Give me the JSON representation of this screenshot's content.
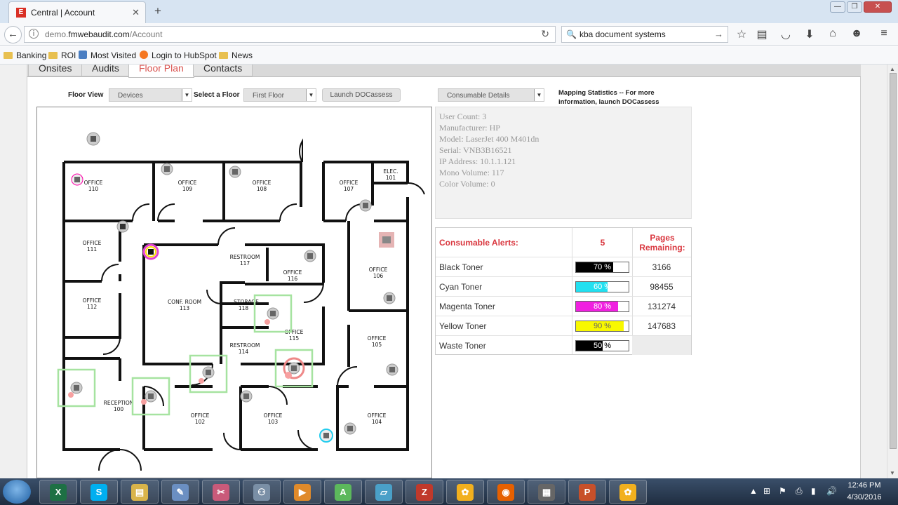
{
  "browser": {
    "tab_title": "Central | Account",
    "tab_favicon": "E",
    "new_tab": "+",
    "url_prefix": "demo.",
    "url_host": "fmwebaudit.com",
    "url_path": "/Account",
    "search_text": "kba document systems",
    "bookmarks": [
      "Banking",
      "ROI",
      "Most Visited",
      "Login to HubSpot",
      "News"
    ]
  },
  "page": {
    "tabs": [
      "Onsites",
      "Audits",
      "Floor Plan",
      "Contacts"
    ],
    "active_tab": "Floor Plan",
    "floor_view_label": "Floor View",
    "floor_view_value": "Devices",
    "select_floor_label": "Select a Floor",
    "select_floor_value": "First Floor",
    "launch_button": "Launch DOCassess",
    "consumable_dropdown": "Consumable Details",
    "mapping_stats_line1": "Mapping Statistics -- For more",
    "mapping_stats_line2": "information, launch DOCassess"
  },
  "device_info": [
    "User Count: 3",
    "Manufacturer: HP",
    "Model: LaserJet 400 M401dn",
    "Serial: VNB3B16521",
    "IP Address: 10.1.1.121",
    "Mono Volume: 117",
    "Color Volume: 0"
  ],
  "consumables": {
    "header_label": "Consumable Alerts:",
    "header_count": "5",
    "header_pages": "Pages Remaining:",
    "accent_color": "#d9363e",
    "rows": [
      {
        "name": "Black Toner",
        "percent": 70,
        "percent_text": "70 %",
        "pages": "3166",
        "color": "#000000"
      },
      {
        "name": "Cyan Toner",
        "percent": 60,
        "percent_text": "60 %",
        "pages": "98455",
        "color": "#22e0f0"
      },
      {
        "name": "Magenta Toner",
        "percent": 80,
        "percent_text": "80 %",
        "pages": "131274",
        "color": "#f020e0"
      },
      {
        "name": "Yellow Toner",
        "percent": 90,
        "percent_text": "90 %",
        "pages": "147683",
        "color": "#f8f800"
      },
      {
        "name": "Waste Toner",
        "percent": 50,
        "percent_text": "50 %",
        "pages": "",
        "color": "#000000"
      }
    ]
  },
  "floorplan": {
    "rooms": [
      {
        "name": "OFFICE",
        "num": "110"
      },
      {
        "name": "OFFICE",
        "num": "109"
      },
      {
        "name": "OFFICE",
        "num": "108"
      },
      {
        "name": "OFFICE",
        "num": "107"
      },
      {
        "name": "ELEC.",
        "num": "101"
      },
      {
        "name": "OFFICE",
        "num": "111"
      },
      {
        "name": "RESTROOM",
        "num": "117"
      },
      {
        "name": "OFFICE",
        "num": "116"
      },
      {
        "name": "OFFICE",
        "num": "106"
      },
      {
        "name": "OFFICE",
        "num": "112"
      },
      {
        "name": "CONF. ROOM",
        "num": "113"
      },
      {
        "name": "STORAGE",
        "num": "118"
      },
      {
        "name": "OFFICE",
        "num": "115"
      },
      {
        "name": "RESTROOM",
        "num": "114"
      },
      {
        "name": "OFFICE",
        "num": "105"
      },
      {
        "name": "RECEPTION",
        "num": "100"
      },
      {
        "name": "OFFICE",
        "num": "102"
      },
      {
        "name": "OFFICE",
        "num": "103"
      },
      {
        "name": "OFFICE",
        "num": "104"
      }
    ]
  },
  "taskbar": {
    "apps": [
      "excel-icon",
      "skype-icon",
      "file-manager-icon",
      "paint-icon",
      "snipping-icon",
      "handshake-icon",
      "media-player-icon",
      "android-icon",
      "notes-icon",
      "filezilla-icon",
      "sunflower-icon",
      "firefox-icon",
      "document-viewer-icon",
      "powerpoint-icon",
      "sunflower-icon"
    ],
    "time": "12:46 PM",
    "date": "4/30/2016"
  }
}
